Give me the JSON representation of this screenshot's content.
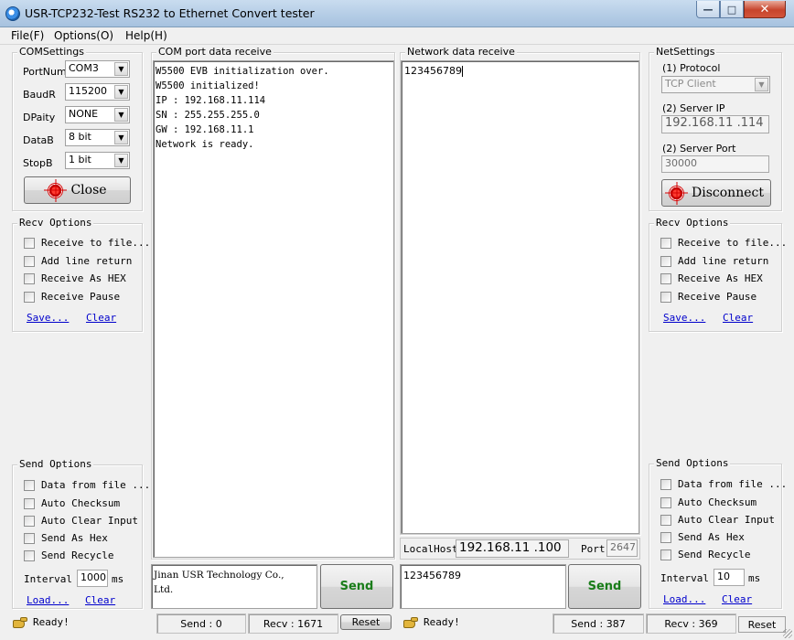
{
  "window": {
    "title": "USR-TCP232-Test  RS232 to Ethernet Convert tester",
    "minimize": "0",
    "maximize": "1",
    "close": "r"
  },
  "menu": {
    "file": "File(F)",
    "options": "Options(O)",
    "help": "Help(H)"
  },
  "com_settings": {
    "title": "COMSettings",
    "port_label": "PortNum",
    "port_value": "COM3",
    "baud_label": "BaudR",
    "baud_value": "115200",
    "parity_label": "DPaity",
    "parity_value": "NONE",
    "databits_label": "DataB",
    "databits_value": "8 bit",
    "stopbits_label": "StopB",
    "stopbits_value": "1 bit",
    "close_button": "Close"
  },
  "com_recv": {
    "title": "COM port data receive",
    "lines": [
      "W5500 EVB initialization over.",
      "W5500 initialized!",
      "IP : 192.168.11.114",
      "SN : 255.255.255.0",
      "GW : 192.168.11.1",
      "Network is ready."
    ]
  },
  "net_recv": {
    "title": "Network data receive",
    "content": "123456789"
  },
  "net_settings": {
    "title": "NetSettings",
    "protocol_label": "(1) Protocol",
    "protocol_value": "TCP Client",
    "server_ip_label": "(2) Server IP",
    "server_ip_value": "192.168.11 .114",
    "server_port_label": "(2) Server Port",
    "server_port_value": "30000",
    "disconnect_button": "Disconnect"
  },
  "left_recv_options": {
    "title": "Recv Options",
    "receive_to_file": "Receive to file...",
    "add_line_return": "Add line return",
    "receive_as_hex": "Receive As HEX",
    "receive_pause": "Receive Pause",
    "save": "Save...",
    "clear": "Clear"
  },
  "right_recv_options": {
    "title": "Recv Options",
    "receive_to_file": "Receive to file...",
    "add_line_return": "Add line return",
    "receive_as_hex": "Receive As HEX",
    "receive_pause": "Receive Pause",
    "save": "Save...",
    "clear": "Clear"
  },
  "left_send_options": {
    "title": "Send Options",
    "data_from_file": "Data from file ...",
    "auto_checksum": "Auto Checksum",
    "auto_clear_input": "Auto Clear Input",
    "send_as_hex": "Send As Hex",
    "send_recycle": "Send Recycle",
    "interval_label": "Interval",
    "interval_value": "1000",
    "interval_unit": "ms",
    "load": "Load...",
    "clear": "Clear"
  },
  "right_send_options": {
    "title": "Send Options",
    "data_from_file": "Data from file ...",
    "auto_checksum": "Auto Checksum",
    "auto_clear_input": "Auto Clear Input",
    "send_as_hex": "Send As Hex",
    "send_recycle": "Send Recycle",
    "interval_label": "Interval",
    "interval_value": "10",
    "interval_unit": "ms",
    "load": "Load...",
    "clear": "Clear"
  },
  "local_host": {
    "label": "LocalHost",
    "value": "192.168.11 .100",
    "port_label": "Port",
    "port_value": "2647"
  },
  "com_send": {
    "lines": [
      "Jinan USR Technology Co.,",
      "Ltd."
    ],
    "button": "Send"
  },
  "net_send": {
    "content": "123456789",
    "button": "Send"
  },
  "status_left": {
    "ready": "Ready!",
    "send": "Send : 0",
    "recv": "Recv : 1671",
    "reset": "Reset"
  },
  "status_right": {
    "ready": "Ready!",
    "send": "Send : 387",
    "recv": "Recv : 369",
    "reset": "Reset"
  }
}
